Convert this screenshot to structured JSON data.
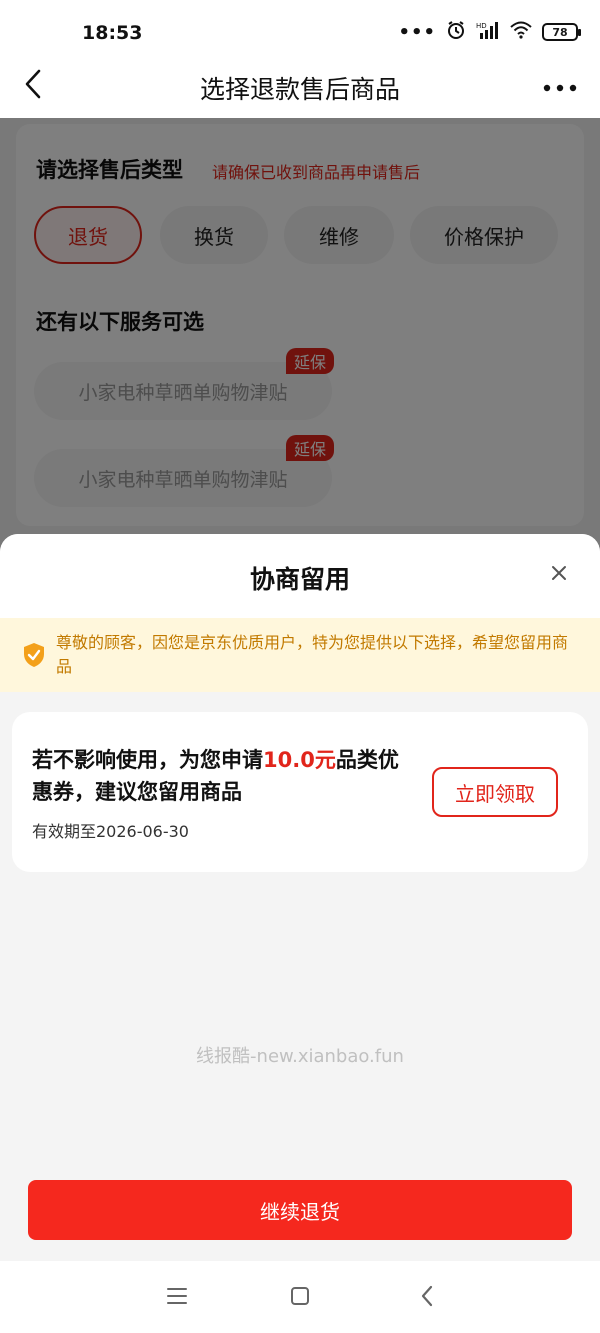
{
  "status_bar": {
    "time": "18:53",
    "dots": "•••",
    "battery": "78",
    "icons": [
      "alarm-icon",
      "signal-icon",
      "wifi-icon",
      "battery-icon"
    ]
  },
  "header": {
    "title": "选择退款售后商品",
    "back_icon": "chevron-left-icon",
    "more_icon": "more-horizontal-icon"
  },
  "after_sale": {
    "title": "请选择售后类型",
    "note": "请确保已收到商品再申请售后",
    "types": [
      {
        "label": "退货",
        "active": true
      },
      {
        "label": "换货",
        "active": false
      },
      {
        "label": "维修",
        "active": false
      },
      {
        "label": "价格保护",
        "active": false
      }
    ]
  },
  "services": {
    "title": "还有以下服务可选",
    "items": [
      {
        "label": "小家电种草晒单购物津贴",
        "tag": "延保"
      },
      {
        "label": "小家电种草晒单购物津贴",
        "tag": "延保"
      }
    ]
  },
  "sheet": {
    "title": "协商留用",
    "close_icon": "close-icon",
    "notice": "尊敬的顾客，因您是京东优质用户，特为您提供以下选择，希望您留用商品",
    "notice_icon": "shield-check-icon",
    "offer": {
      "text_before": "若不影响使用，为您申请",
      "amount": "10.0元",
      "text_after": "品类优惠券，建议您留用商品",
      "expiry": "有效期至2026-06-30",
      "button": "立即领取"
    },
    "watermark": "线报酷-new.xianbao.fun",
    "continue_button": "继续退货"
  },
  "nav_bar": {
    "icons": [
      "menu-icon",
      "home-square-icon",
      "back-triangle-icon"
    ]
  },
  "colors": {
    "accent": "#e1251b",
    "primary_button": "#f5281e",
    "notice_bg": "#fff7dc",
    "notice_text": "#c27a00"
  }
}
